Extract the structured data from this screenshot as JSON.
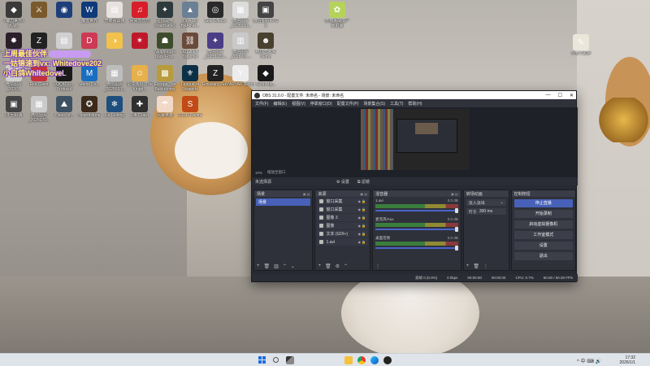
{
  "desktop": {
    "streamer_lines": [
      "上周最佳伙伴",
      "一姑锦速到vx: Whitedove202",
      "小白鸽Whitedove"
    ],
    "icons": [
      {
        "label": "《魔力世界》大战...",
        "color": "#3a3a3a",
        "glyph": "◆"
      },
      {
        "label": "",
        "color": "#7a5a2c",
        "glyph": "⚔"
      },
      {
        "label": "",
        "color": "#1f3f7a",
        "glyph": "◉"
      },
      {
        "label": "魔兽世界",
        "color": "#0e3a7a",
        "glyph": "W"
      },
      {
        "label": "开菜网山陵",
        "color": "#e7e1e0",
        "glyph": "▤"
      },
      {
        "label": "网易云音乐",
        "color": "#d81e2a",
        "glyph": "♫"
      },
      {
        "label": "星际战甲 (Warframe)",
        "color": "#2c3a3d",
        "glyph": "✦"
      },
      {
        "label": "Only Up BRAINR...",
        "color": "#6b7f95",
        "glyph": "▲"
      },
      {
        "label": "Side Effects",
        "color": "#2a2a2a",
        "glyph": "◎"
      },
      {
        "label": "微信图片_2026010...",
        "color": "#dcdcdc",
        "glyph": "▦"
      },
      {
        "label": "微信图片RPG 2",
        "color": "#444",
        "glyph": "▣"
      },
      {
        "label": "Dome Keeper 符...",
        "color": "#2b1f2a",
        "glyph": "✸"
      },
      {
        "label": "植物大战僵尸家庭版",
        "color": "#b5d35b",
        "glyph": "✿"
      },
      {
        "label": "小萝卜助手",
        "color": "#eae6da",
        "glyph": "✎"
      },
      {
        "label": "",
        "color": "#222",
        "glyph": "Z"
      },
      {
        "label": "",
        "color": "#d0d0d0",
        "glyph": "▤"
      },
      {
        "label": "",
        "color": "#cd3a54",
        "glyph": "D"
      },
      {
        "label": "",
        "color": "#f3c24c",
        "glyph": "◑"
      },
      {
        "label": "",
        "color": "#c0182b",
        "glyph": "✶"
      },
      {
        "label": "Neighbours back Fro...",
        "color": "#3d4d2c",
        "glyph": "☗"
      },
      {
        "label": "Chained Together",
        "color": "#6a4a3a",
        "glyph": "⛓"
      },
      {
        "label": "微信图片_20251231...",
        "color": "#4b3d86",
        "glyph": "✦"
      },
      {
        "label": "微信图片_2026-01-...",
        "color": "#c9c9c9",
        "glyph": "▥"
      },
      {
        "label": "被打艺术家 Demo",
        "color": "#4a4030",
        "glyph": "☻"
      },
      {
        "label": "微信图片_2026...",
        "color": "#cfcfcf",
        "glyph": "▦"
      },
      {
        "label": "Riot Client",
        "color": "#c7313a",
        "glyph": "R"
      },
      {
        "label": "LOCKDO... Protocol",
        "color": "#1a1a1a",
        "glyph": "L"
      },
      {
        "label": "MemoTra...",
        "color": "#1a6ec0",
        "glyph": "M"
      },
      {
        "label": "微信图片_2025093...",
        "color": "#bdbdbd",
        "glyph": "▦"
      },
      {
        "label": "蛋仔派对 (The Kingd...",
        "color": "#e7b04b",
        "glyph": "☺"
      },
      {
        "label": "Escape The Backrooms",
        "color": "#b89b3c",
        "glyph": "▩"
      },
      {
        "label": "League of Legends",
        "color": "#0b2f47",
        "glyph": "⚜"
      },
      {
        "label": "Emissary Zero",
        "color": "#222",
        "glyph": "Z"
      },
      {
        "label": "YAPYAP Demo",
        "color": "#ececec",
        "glyph": "Y"
      },
      {
        "label": "NeonAby...",
        "color": "#1a1a1a",
        "glyph": "◆"
      },
      {
        "label": "UI 回顾版",
        "color": "#444",
        "glyph": "▣"
      },
      {
        "label": "微信图片_2025070...",
        "color": "#cacaca",
        "glyph": "▦"
      },
      {
        "label": "Plains of...",
        "color": "#3e5163",
        "glyph": "⛰"
      },
      {
        "label": "Hearthstone",
        "color": "#3b2a1c",
        "glyph": "✪"
      },
      {
        "label": "Ice Fishing",
        "color": "#1d4e7e",
        "glyph": "❄"
      },
      {
        "label": "Rift Crawl",
        "color": "#2f2f2f",
        "glyph": "✚"
      },
      {
        "label": "风暴英雄",
        "color": "#f2d8c6",
        "glyph": "☂"
      },
      {
        "label": "S.C.K Centre",
        "color": "#c14a16",
        "glyph": "S"
      }
    ]
  },
  "obs": {
    "title": "OBS 31.0.0 - 配置文件: 未命名 - 场景: 未命名",
    "window_buttons": [
      "—",
      "☐",
      "✕"
    ],
    "menu": [
      "文件(F)",
      "编辑(E)",
      "视图(V)",
      "停靠窗口(D)",
      "配置文件(P)",
      "场景集合(S)",
      "工具(T)",
      "帮助(H)"
    ],
    "zoom": "10%",
    "zoom_label": "缩放至窗口",
    "source_bar": {
      "label": "未选择源",
      "settings": "⚙ 设置",
      "filters": "⧉ 滤镜"
    },
    "docks": {
      "scenes": {
        "title": "场景",
        "items": [
          "场景"
        ]
      },
      "sources": {
        "title": "来源",
        "items": [
          "窗口采集",
          "窗口采集",
          "图像 3",
          "图像",
          "文本 (GDI+)",
          "1.avi"
        ]
      },
      "mixer": {
        "title": "混音器",
        "channels": [
          {
            "name": "1.avi",
            "db": "0.0 dB",
            "level": 0.9
          },
          {
            "name": "麦克风/Aux",
            "db": "0.0 dB",
            "level": 0.85
          },
          {
            "name": "桌面音频",
            "db": "0.0 dB",
            "level": 0.8
          }
        ]
      },
      "transitions": {
        "title": "转场动画",
        "type": "淡入淡出",
        "duration_label": "时长",
        "duration": "300 ms"
      },
      "controls": {
        "title": "控制按钮",
        "buttons": [
          "停止直播",
          "开始录制",
          "启动虚拟摄像机",
          "工作室模式",
          "设置",
          "退出"
        ]
      }
    },
    "status": {
      "dropped": "丢帧 0 (0.0%)",
      "bitrate": "0 kbps",
      "stream_time": "00:00:00",
      "rec_time": "00:00:00",
      "cpu": "CPU: 0.7%",
      "fps": "60.00 / 60.00 FPS"
    }
  },
  "taskbar": {
    "time": "17:32",
    "date": "2026/1/1",
    "tray": "^ 中 ⌨ 🔊"
  }
}
